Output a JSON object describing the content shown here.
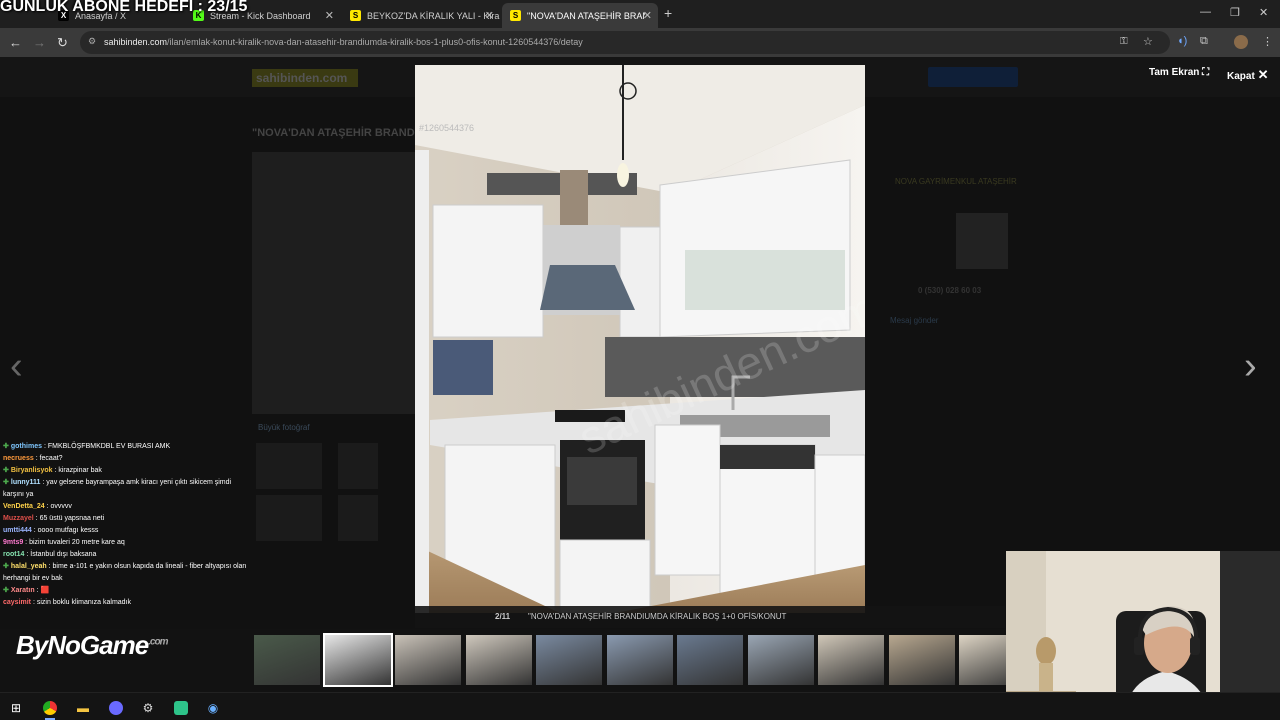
{
  "stream": {
    "goal_text": "GÜNLÜK ABONE HEDEFİ : 23/15",
    "brand": "ByNoGame",
    "brand_suffix": ".com"
  },
  "browser": {
    "tabs": [
      {
        "label": "Anasayfa / X",
        "active": false
      },
      {
        "label": "Stream - Kick Dashboard",
        "active": false
      },
      {
        "label": "BEYKOZ'DA KİRALIK YALI - Kiralı",
        "active": false
      },
      {
        "label": "\"NOVA'DAN ATAŞEHİR BRANDI",
        "active": true
      }
    ],
    "url_domain": "sahibinden.com",
    "url_path": "/ilan/emlak-konut-kiralik-nova-dan-atasehir-brandiumda-kiralik-bos-1-plus0-ofis-konut-1260544376/detay"
  },
  "lightbox": {
    "listing_id": "#1260544376",
    "fullscreen_label": "Tam Ekran",
    "close_label": "Kapat",
    "counter": "2/11",
    "caption": "\"NOVA'DAN ATAŞEHİR BRANDIUMDA KİRALIK BOŞ 1+0 OFİS/KONUT",
    "watermark": "sahibinden.com",
    "thumb_count": 11,
    "active_thumb": 1
  },
  "page_bg": {
    "logo": "sahibinden.com",
    "title": "\"NOVA'DAN ATAŞEHİR BRAND",
    "agency": "NOVA GAYRİMENKUL ATAŞEHİR",
    "phone": "0 (530) 028 60 03",
    "big_photo": "Büyük fotoğraf",
    "messages": "Mesaj gönder"
  },
  "chat": [
    {
      "user": "gothimes",
      "color": "#7fc7ff",
      "plus": true,
      "text": "FMKBLÖŞFBMKDBL EV BURASI AMK"
    },
    {
      "user": "necruess",
      "color": "#ff9a3c",
      "plus": false,
      "text": "fecaat?"
    },
    {
      "user": "Biryanlisyok",
      "color": "#f3c242",
      "plus": true,
      "text": "kirazpinar bak"
    },
    {
      "user": "lunny111",
      "color": "#b0e0ff",
      "plus": true,
      "text": "yav gelsene bayrampaşa amk kiracı yeni çıktı sikicem şimdi karşını ya"
    },
    {
      "user": "VenDetta_24",
      "color": "#ffd24a",
      "plus": false,
      "text": "ovvvvv"
    },
    {
      "user": "Muzzayel",
      "color": "#e0504a",
      "plus": false,
      "text": "65 üstü yapsnaa neti"
    },
    {
      "user": "umtti444",
      "color": "#9bb5ff",
      "plus": false,
      "text": "oooo mutfagı kesss"
    },
    {
      "user": "9mts9",
      "color": "#ff7ad0",
      "plus": false,
      "text": "bizim tuvaleri 20 metre kare aq"
    },
    {
      "user": "root14",
      "color": "#86e3b0",
      "plus": false,
      "text": "İstanbul dışı baksana"
    },
    {
      "user": "halal_yeah",
      "color": "#ffe06b",
      "plus": true,
      "text": "bime a-101 e yakın olsun kapıda da lineali - fiber altyapısı olan herhangi bir ev bak"
    },
    {
      "user": "Xaratın",
      "color": "#ff8a8a",
      "plus": true,
      "text": "🟥"
    },
    {
      "user": "caysimit",
      "color": "#ff6a6a",
      "plus": false,
      "text": "sizin boklu klimanıza kalmadık"
    }
  ]
}
